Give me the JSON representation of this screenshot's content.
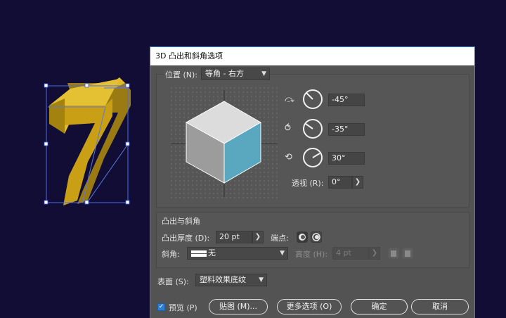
{
  "dialog": {
    "title": "3D 凸出和斜角选项"
  },
  "position": {
    "label": "位置 (N):",
    "preset": "等角 - 右方",
    "rotate_x": "-45°",
    "rotate_y": "-35°",
    "rotate_z": "30°",
    "perspective_label": "透视 (R):",
    "perspective_value": "0°"
  },
  "extrude_bevel": {
    "section_title": "凸出与斜角",
    "depth_label": "凸出厚度 (D):",
    "depth_value": "20 pt",
    "cap_label": "端点:",
    "bevel_label": "斜角:",
    "bevel_value": "无",
    "height_label": "高度 (H):",
    "height_value": "4 pt"
  },
  "surface": {
    "label": "表面 (S):",
    "value": "塑料效果底纹"
  },
  "footer": {
    "preview_label": "预览 (P)",
    "preview_checked": true,
    "map_button": "贴图 (M)...",
    "more_options_button": "更多选项 (O)",
    "ok_button": "确定",
    "cancel_button": "取消"
  },
  "colors": {
    "canvas_bg": "#120d35",
    "dialog_bg": "#535353",
    "accent": "#2d7fd6",
    "object_gold": "#d4ac1c",
    "cube_front": "#5aa7c0"
  }
}
